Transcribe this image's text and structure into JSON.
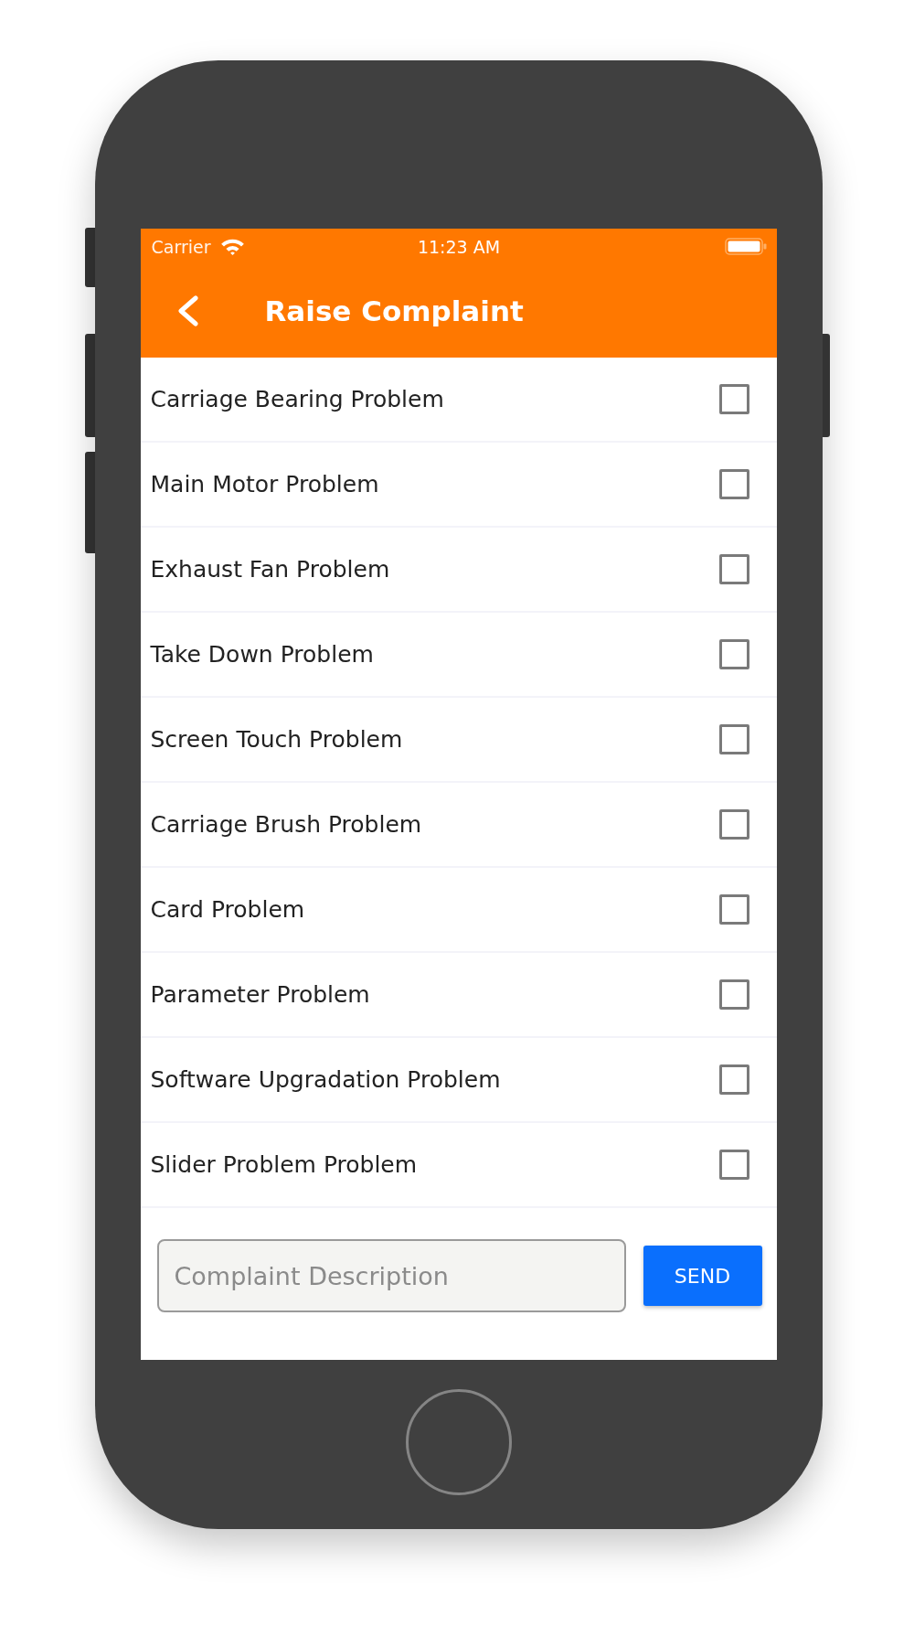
{
  "status_bar": {
    "carrier": "Carrier",
    "time": "11:23 AM"
  },
  "header": {
    "title": "Raise Complaint"
  },
  "complaints": [
    {
      "label": "Carriage Bearing Problem",
      "checked": false
    },
    {
      "label": "Main Motor Problem",
      "checked": false
    },
    {
      "label": "Exhaust Fan Problem",
      "checked": false
    },
    {
      "label": "Take Down Problem",
      "checked": false
    },
    {
      "label": "Screen Touch Problem",
      "checked": false
    },
    {
      "label": "Carriage Brush Problem",
      "checked": false
    },
    {
      "label": "Card Problem",
      "checked": false
    },
    {
      "label": "Parameter Problem",
      "checked": false
    },
    {
      "label": "Software Upgradation Problem",
      "checked": false
    },
    {
      "label": "Slider Problem Problem",
      "checked": false
    }
  ],
  "description": {
    "placeholder": "Complaint Description"
  },
  "send_button": {
    "label": "SEND"
  }
}
